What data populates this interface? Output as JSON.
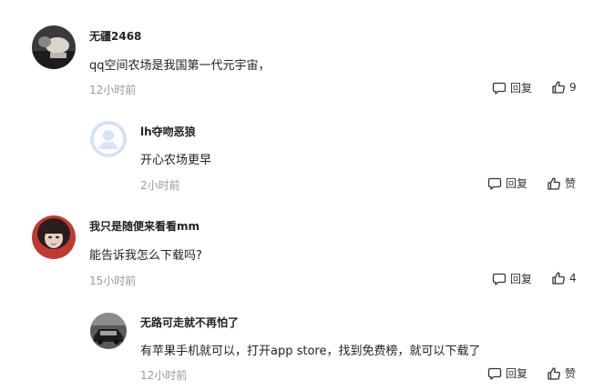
{
  "comments": [
    {
      "username": "无疆2468",
      "content": "qq空间农场是我国第一代元宇宙，",
      "time": "12小时前",
      "reply_label": "回复",
      "like_label": "9",
      "avatar": "dark-photo-avatar"
    },
    {
      "username": "lh夺吻恶狼",
      "content": "开心农场更早",
      "time": "2小时前",
      "reply_label": "回复",
      "like_label": "赞",
      "avatar": "default-user-avatar"
    },
    {
      "username": "我只是随便来看看mm",
      "content": "能告诉我怎么下载吗?",
      "time": "15小时前",
      "reply_label": "回复",
      "like_label": "4",
      "avatar": "girl-photo-avatar"
    },
    {
      "username": "无路可走就不再怕了",
      "content": "有苹果手机就可以，打开app store，找到免费榜，就可以下载了",
      "time": "12小时前",
      "reply_label": "回复",
      "like_label": "赞",
      "avatar": "car-photo-avatar"
    }
  ],
  "icons": {
    "reply": "comment-bubble-icon",
    "like": "thumbs-up-icon"
  },
  "colors": {
    "username": "#222222",
    "timestamp": "#999999",
    "action": "#333333"
  }
}
